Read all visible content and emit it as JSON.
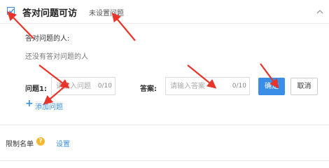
{
  "header": {
    "checked": true,
    "title": "答对问题可访",
    "status": "未设置问题"
  },
  "people": {
    "label": "答对问题的人:",
    "empty_text": "还没有答对问题的人"
  },
  "question_form": {
    "question_label": "问题1:",
    "question_placeholder": "请输入问题",
    "question_count": "0/10",
    "answer_label": "答案:",
    "answer_placeholder": "请输入答案",
    "answer_count": "0/10",
    "confirm_label": "确定",
    "cancel_label": "取消"
  },
  "add_question": {
    "icon": "plus-icon",
    "label": "添加问题"
  },
  "limit": {
    "label": "限制名单",
    "help_icon": "?",
    "action": "设置"
  },
  "colors": {
    "accent": "#3a8ee6",
    "annotation_arrow": "#e8352b",
    "help_badge": "#f5b82e"
  }
}
